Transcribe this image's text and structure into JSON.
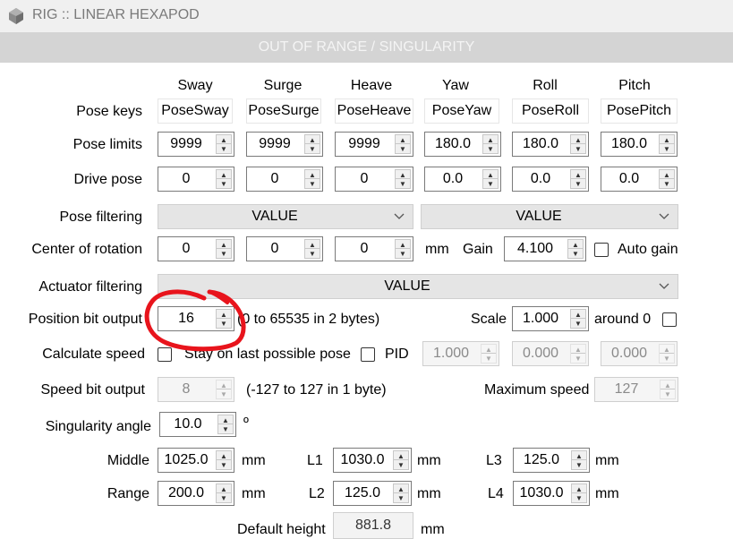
{
  "window": {
    "title": "RIG :: LINEAR HEXAPOD",
    "banner": "OUT OF RANGE / SINGULARITY"
  },
  "axes": {
    "headers": [
      "Sway",
      "Surge",
      "Heave",
      "Yaw",
      "Roll",
      "Pitch"
    ]
  },
  "rows": {
    "pose_keys": {
      "label": "Pose keys",
      "values": [
        "PoseSway",
        "PoseSurge",
        "PoseHeave",
        "PoseYaw",
        "PoseRoll",
        "PosePitch"
      ]
    },
    "pose_limits": {
      "label": "Pose limits",
      "values": [
        "9999",
        "9999",
        "9999",
        "180.0",
        "180.0",
        "180.0"
      ]
    },
    "drive_pose": {
      "label": "Drive pose",
      "values": [
        "0",
        "0",
        "0",
        "0.0",
        "0.0",
        "0.0"
      ]
    },
    "pose_filtering": {
      "label": "Pose filtering",
      "values": [
        "VALUE",
        "VALUE"
      ]
    },
    "center_of_rotation": {
      "label": "Center of rotation",
      "values": [
        "0",
        "0",
        "0"
      ],
      "unit": "mm",
      "gain_label": "Gain",
      "gain": "4.100",
      "auto_gain_label": "Auto gain"
    },
    "actuator_filtering": {
      "label": "Actuator filtering",
      "value": "VALUE"
    },
    "position_bit_output": {
      "label": "Position bit output",
      "value": "16",
      "range_text": "(0 to 65535 in 2 bytes)",
      "scale_label": "Scale",
      "scale": "1.000",
      "around_label": "around 0"
    },
    "calculate_speed": {
      "label": "Calculate speed",
      "stay_label": "Stay on last possible pose",
      "pid_label": "PID",
      "pid_values": [
        "1.000",
        "0.000",
        "0.000"
      ]
    },
    "speed_bit_output": {
      "label": "Speed bit output",
      "value": "8",
      "range_text": "(-127 to 127 in 1 byte)",
      "max_speed_label": "Maximum speed",
      "max_speed": "127"
    },
    "singularity": {
      "label": "Singularity angle",
      "value": "10.0",
      "unit": "º"
    },
    "middle": {
      "label": "Middle",
      "value": "1025.0",
      "unit": "mm"
    },
    "range": {
      "label": "Range",
      "value": "200.0",
      "unit": "mm"
    },
    "l1": {
      "label": "L1",
      "value": "1030.0",
      "unit": "mm"
    },
    "l2": {
      "label": "L2",
      "value": "125.0",
      "unit": "mm"
    },
    "l3": {
      "label": "L3",
      "value": "125.0",
      "unit": "mm"
    },
    "l4": {
      "label": "L4",
      "value": "1030.0",
      "unit": "mm"
    },
    "default_height": {
      "label": "Default height",
      "value": "881.8",
      "unit": "mm"
    }
  },
  "colors": {
    "annotation": "#e8141c",
    "banner_bg": "#d4d4d4",
    "titlebar_bg": "#f0f0f0"
  }
}
